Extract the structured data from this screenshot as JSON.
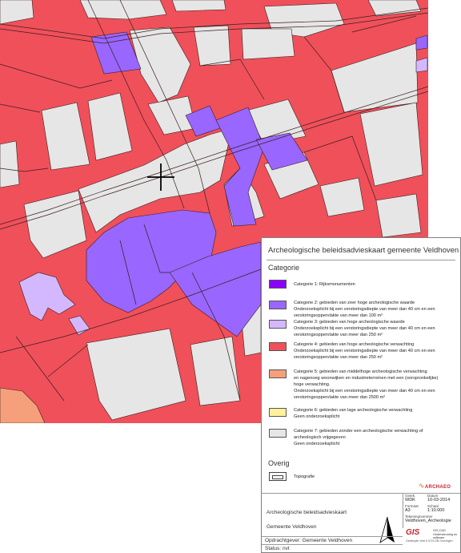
{
  "map": {
    "colors": {
      "cat1": "#8b00ff",
      "cat2": "#9966ff",
      "cat3": "#d4b8ff",
      "cat4": "#f0505a",
      "cat5": "#f5a07a",
      "cat6": "#fff29a",
      "cat7": "#e6e6e6",
      "topo_line": "#3a1f1f",
      "background": "#ffffff"
    },
    "crosshair_icon": "crosshair-icon"
  },
  "legend": {
    "title": "Archeologische beleidsadvieskaart gemeente Veldhoven",
    "section_categorie": "Categorie",
    "categories": [
      {
        "id": "cat1",
        "lines": [
          "Categorie 1: Rijksmonumenten"
        ],
        "color": "#8b00ff"
      },
      {
        "id": "cat2",
        "lines": [
          "Categorie 2: gebieden van zeer hoge archeologische waarde",
          "Onderzoeksplicht bij een verstoringsdiepte van meer dan 40 cm en een",
          "verstoringsoppervlakte van meer dan 100 m²"
        ],
        "color": "#9966ff"
      },
      {
        "id": "cat3",
        "lines": [
          "Categorie 3: gebieden van hoge archeologische waarde",
          "Onderzoeksplicht bij een verstoringsdiepte van meer dan 40 cm en een",
          "verstoringsoppervlakte van meer dan 250 m²"
        ],
        "color": "#d4b8ff"
      },
      {
        "id": "cat4",
        "lines": [
          "Categorie 4: gebieden van hoge archeologische verwachting",
          "Onderzoeksplicht bij een verstoringsdiepte van meer dan 40 cm en een",
          "verstoringsoppervlakte van meer dan 250 m²"
        ],
        "color": "#f0505a"
      },
      {
        "id": "cat5",
        "lines": [
          "Categorie 5: gebieden van middelhoge archeologische verwachting",
          "en nagenoeg woonwijken en industrieterreinen met een (oorspronkelijke)",
          "hoge verwachting.",
          "Onderzoeksplicht bij een verstoringsdiepte van meer dan 40 cm en een",
          "verstoringsoppervlakte van meer dan 2500 m²"
        ],
        "color": "#f5a07a"
      },
      {
        "id": "cat6",
        "lines": [
          "Categorie 6: gebieden van lage archeologische verwachting",
          "Geen onderzoeksplicht"
        ],
        "color": "#fff29a"
      },
      {
        "id": "cat7",
        "lines": [
          "Categorie 7: gebieden zonder een archeologische verwachting of",
          "archeologisch vrijgegeven",
          "Geen onderzoeksplicht"
        ],
        "color": "#e6e6e6"
      }
    ],
    "section_overig": "Overig",
    "topografie_label": "Topografie",
    "logo_text": "ARCHAEO"
  },
  "title_block": {
    "meta": {
      "getek_label": "Getek.",
      "getek_value": "WDK",
      "datum_label": "Datum",
      "datum_value": "10-03-2014",
      "formaat_label": "Formaat",
      "formaat_value": "A3",
      "schaal_label": "Schaal",
      "schaal_value": "1:10.000",
      "tekening_label": "Tekeningnummer",
      "tekening_value": "Veldhoven_Archeologie"
    },
    "main_title": "Archeologische beleidsadvieskaart",
    "subtitle": "Gemeente Veldhoven",
    "opdrachtgever": "Opdrachtgever: Gemeente Veldhoven",
    "status": "Status: nvt",
    "gis_logo": "GIS",
    "gis_caption": "GIS-CAD Ondersteuning en software",
    "gis_address": "Gedempte Vest 5  9724 ZB Groningen"
  }
}
